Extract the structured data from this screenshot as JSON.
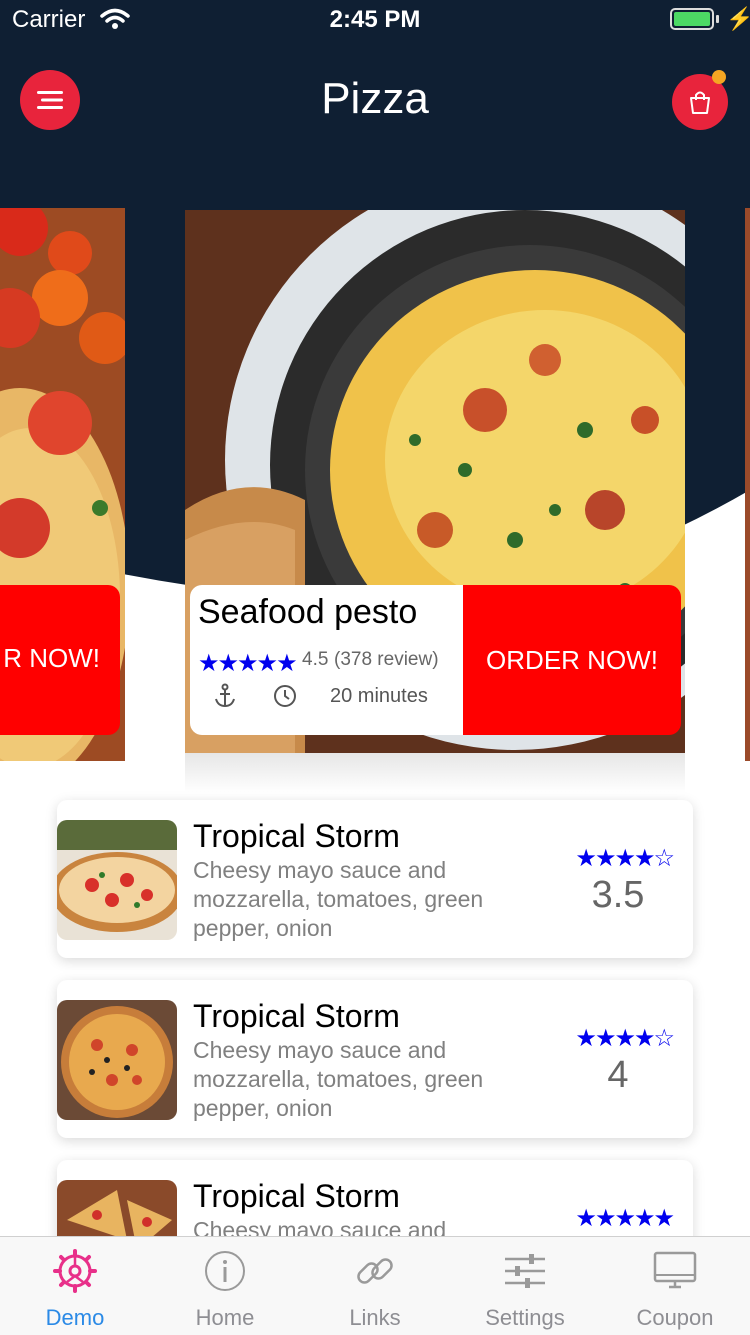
{
  "status_bar": {
    "carrier": "Carrier",
    "time": "2:45 PM",
    "battery_level": 1.0
  },
  "nav": {
    "title": "Pizza",
    "menu_icon": "menu-icon",
    "cart_icon": "shopping-bag-icon",
    "cart_badge_color": "#f5a623"
  },
  "colors": {
    "navy": "#0f1f33",
    "red": "#ff0000",
    "accent": "#e8243c",
    "star_blue": "#0000ee",
    "tab_active": "#2b8ae6"
  },
  "featured": {
    "left_card": {
      "button_label": "R NOW!"
    },
    "main_card": {
      "title": "Seafood pesto",
      "stars": "★★★★★",
      "rating": "4.5",
      "reviews": "(378 review)",
      "time": "20 minutes",
      "button_label": "ORDER NOW!"
    }
  },
  "list": [
    {
      "title": "Tropical Storm",
      "description": "Cheesy mayo sauce and mozzarella, tomatoes, green pepper, onion",
      "stars": "★★★★☆",
      "score": "3.5"
    },
    {
      "title": "Tropical Storm",
      "description": "Cheesy mayo sauce and mozzarella, tomatoes, green pepper, onion",
      "stars": "★★★★☆",
      "score": "4"
    },
    {
      "title": "Tropical Storm",
      "description": "Cheesy mayo sauce and",
      "stars": "★★★★★",
      "score": ""
    }
  ],
  "tabs": [
    {
      "label": "Demo",
      "icon": "gear-icon",
      "active": true
    },
    {
      "label": "Home",
      "icon": "info-icon",
      "active": false
    },
    {
      "label": "Links",
      "icon": "link-icon",
      "active": false
    },
    {
      "label": "Settings",
      "icon": "sliders-icon",
      "active": false
    },
    {
      "label": "Coupon",
      "icon": "monitor-icon",
      "active": false
    }
  ]
}
